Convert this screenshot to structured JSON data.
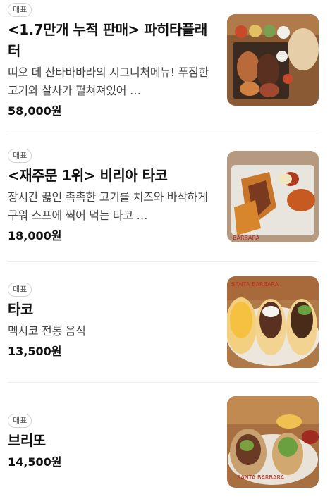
{
  "badge_label": "대표",
  "items": [
    {
      "title": "<1.7만개 누적 판매> 파히타플래터",
      "description": "띠오 데 산타바바라의 시그니처메뉴! 푸짐한 고기와 살사가 펼쳐져있어 …",
      "price": "58,000원",
      "image_icon": "fajita-platter-photo"
    },
    {
      "title": "<재주문 1위> 비리아 타코",
      "description": "장시간 끓인 촉촉한 고기를 치즈와 바삭하게 구워 스프에 찍어 먹는 타코 …",
      "price": "18,000원",
      "image_icon": "birria-taco-photo"
    },
    {
      "title": "타코",
      "description": "멕시코 전통 음식",
      "price": "13,500원",
      "image_icon": "taco-photo"
    },
    {
      "title": "브리또",
      "description": "",
      "price": "14,500원",
      "image_icon": "burrito-photo"
    }
  ]
}
